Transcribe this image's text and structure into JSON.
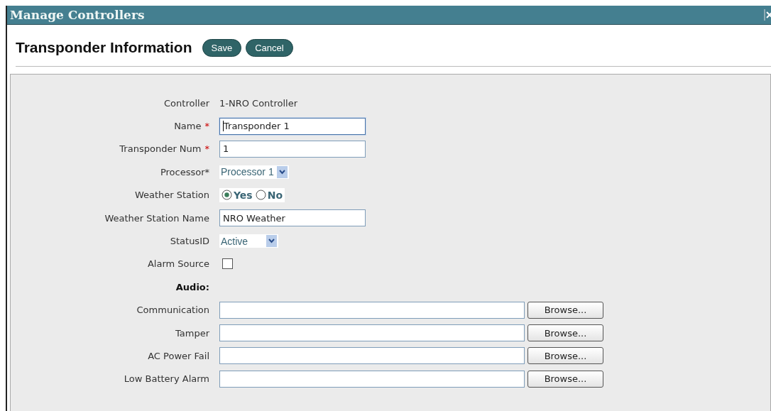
{
  "window": {
    "title": "Manage Controllers"
  },
  "heading": "Transponder Information",
  "buttons": [
    "Save",
    "Cancel"
  ],
  "rows": [
    {
      "kind": "text",
      "label": "Controller",
      "value": "1-NRO Controller"
    },
    {
      "kind": "input",
      "label": "Name",
      "required_mark": "*",
      "value": "Transponder 1",
      "focused": true
    },
    {
      "kind": "input",
      "label": "Transponder Num",
      "required_mark": "*",
      "value": "1",
      "focused": false
    },
    {
      "kind": "select",
      "label": "Processor*",
      "value": "Processor 1"
    },
    {
      "kind": "radio",
      "label": "Weather Station",
      "options": [
        {
          "label": "Yes",
          "selected": true
        },
        {
          "label": "No",
          "selected": false
        }
      ]
    },
    {
      "kind": "input",
      "label": "Weather Station Name",
      "value": "NRO Weather",
      "focused": false
    },
    {
      "kind": "select",
      "label": "StatusID",
      "value": "Active"
    },
    {
      "kind": "checkbox",
      "label": "Alarm Source",
      "checked": false
    },
    {
      "kind": "section",
      "label": "Audio:"
    },
    {
      "kind": "file",
      "label": "Communication",
      "button": "Browse..."
    },
    {
      "kind": "file",
      "label": "Tamper",
      "button": "Browse..."
    },
    {
      "kind": "file",
      "label": "AC Power Fail",
      "button": "Browse..."
    },
    {
      "kind": "file",
      "label": "Low Battery Alarm",
      "button": "Browse..."
    }
  ]
}
